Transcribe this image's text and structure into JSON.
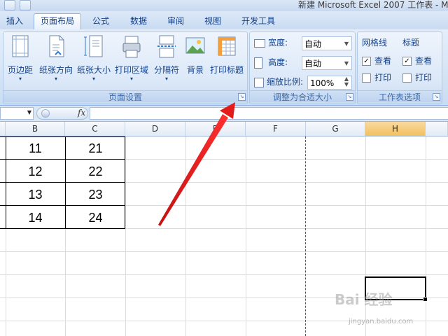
{
  "window": {
    "title": "新建 Microsoft Excel 2007 工作表 - M"
  },
  "tabs": [
    "插入",
    "页面布局",
    "公式",
    "数据",
    "审阅",
    "视图",
    "开发工具"
  ],
  "active_tab": "页面布局",
  "page_setup": {
    "buttons": [
      "页边距",
      "纸张方向",
      "纸张大小",
      "打印区域",
      "分隔符",
      "背景",
      "打印标题"
    ],
    "group_label": "页面设置"
  },
  "scale_to_fit": {
    "width_label": "宽度:",
    "width_value": "自动",
    "height_label": "高度:",
    "height_value": "自动",
    "scale_label": "缩放比例:",
    "scale_value": "100%",
    "group_label": "调整为合适大小"
  },
  "sheet_options": {
    "gridlines_label": "网格线",
    "headings_label": "标题",
    "view_label": "查看",
    "print_label": "打印",
    "gridlines_view": true,
    "gridlines_print": false,
    "headings_view": true,
    "headings_print": false,
    "group_label": "工作表选项"
  },
  "formula_bar": {
    "fx": "fx"
  },
  "columns": [
    "B",
    "C",
    "D",
    "E",
    "F",
    "G",
    "H"
  ],
  "selected_column": "H",
  "cells": {
    "B": [
      "11",
      "12",
      "13",
      "14"
    ],
    "C": [
      "21",
      "22",
      "23",
      "24"
    ]
  },
  "watermark": {
    "main": "Bai 经验",
    "sub": "jingyan.baidu.com"
  },
  "colors": {
    "accent": "#15428b",
    "arrow": "#e31b1b",
    "selected_header": "#f1c15f"
  }
}
